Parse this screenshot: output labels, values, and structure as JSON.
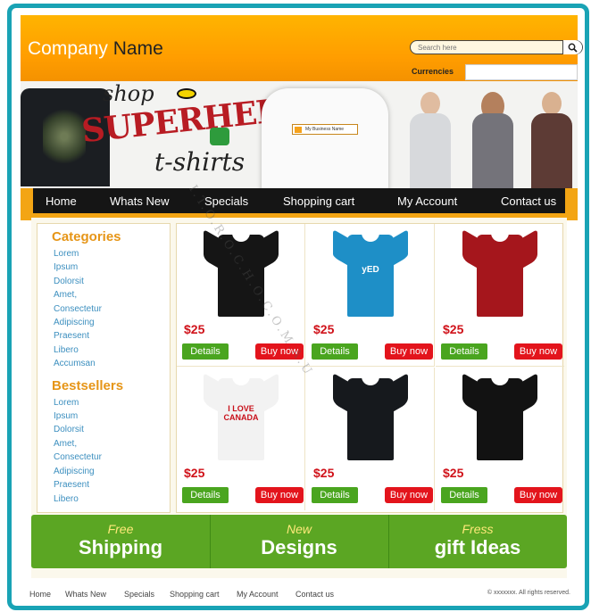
{
  "header": {
    "company_first": "Company",
    "company_second": " Name",
    "search_placeholder": "Search here",
    "currencies_label": "Currencies",
    "currency_value": ""
  },
  "banner": {
    "shop": "shop",
    "superhero": "SUPERHERO",
    "tshirts": "t-shirts",
    "tag_text": "My Business Name"
  },
  "nav": {
    "items": [
      "Home",
      "Whats New",
      "Specials",
      "Shopping cart",
      "My Account",
      "Contact us"
    ]
  },
  "sidebar": {
    "categories_title": "Categories",
    "categories": [
      "Lorem",
      "Ipsum",
      "Dolorsit",
      "Amet,",
      "Consectetur",
      "Adipiscing",
      "Praesent",
      "Libero",
      "Accumsan"
    ],
    "bestsellers_title": "Bestsellers",
    "bestsellers": [
      "Lorem",
      "Ipsum",
      "Dolorsit",
      "Amet,",
      "Consectetur",
      "Adipiscing",
      "Praesent",
      "Libero"
    ]
  },
  "products": [
    {
      "price": "$25",
      "details": "Details",
      "buy": "Buy now",
      "color": "#151515",
      "print": ""
    },
    {
      "price": "$25",
      "details": "Details",
      "buy": "Buy now",
      "color": "#1e8fc7",
      "print": "yED"
    },
    {
      "price": "$25",
      "details": "Details",
      "buy": "Buy now",
      "color": "#a5161c",
      "print": ""
    },
    {
      "price": "$25",
      "details": "Details",
      "buy": "Buy now",
      "color": "#f2f2f2",
      "print": "I LOVE CANADA"
    },
    {
      "price": "$25",
      "details": "Details",
      "buy": "Buy now",
      "color": "#16191d",
      "print": ""
    },
    {
      "price": "$25",
      "details": "Details",
      "buy": "Buy now",
      "color": "#121212",
      "print": ""
    }
  ],
  "promo": [
    {
      "small": "Free",
      "big": "Shipping"
    },
    {
      "small": "New",
      "big": "Designs"
    },
    {
      "small": "Fress",
      "big": "gift Ideas"
    }
  ],
  "footer": {
    "links": [
      "Home",
      "Whats New",
      "Specials",
      "Shopping cart",
      "My Account",
      "Contact us"
    ],
    "copyright": "© xxxxxxx. All rights reserved."
  },
  "watermark": "I.T.O.R.O.C.H.O.C.O.M.A.U",
  "colors": {
    "frame": "#19a3b5",
    "header_orange": "#ffa800",
    "nav_black": "#151515",
    "category_heading": "#e69517",
    "link_blue": "#3c8fbf",
    "price_red": "#d0121a",
    "details_green": "#4aa51f",
    "buy_red": "#e3141c",
    "promo_green": "#5ba623"
  }
}
